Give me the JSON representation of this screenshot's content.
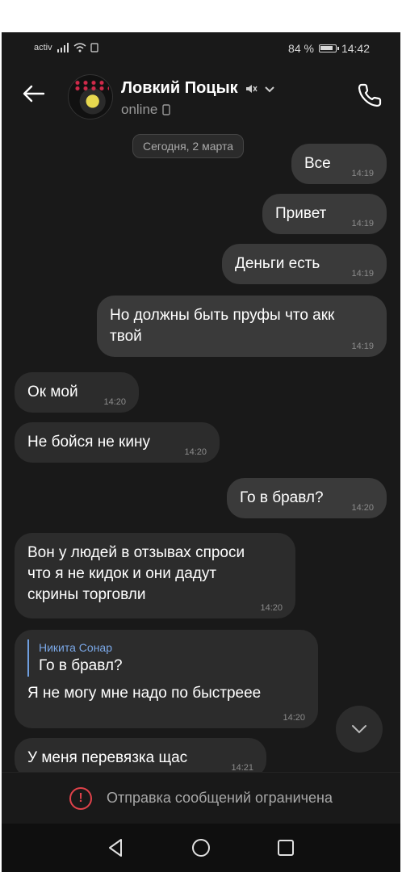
{
  "statusbar": {
    "carrier": "activ",
    "battery": "84 %",
    "time": "14:42"
  },
  "header": {
    "contact_name": "Ловкий Поцык",
    "status": "online",
    "icons": [
      "back-arrow-icon",
      "muted-icon",
      "chevron-down-icon",
      "phone-icon"
    ]
  },
  "date_separator": "Сегодня, 2 марта",
  "messages": [
    {
      "dir": "out",
      "text": "Все",
      "time": "14:19"
    },
    {
      "dir": "out",
      "text": "Привет",
      "time": "14:19"
    },
    {
      "dir": "out",
      "text": "Деньги есть",
      "time": "14:19"
    },
    {
      "dir": "out",
      "text": "Но должны быть пруфы что акк\nтвой",
      "time": "14:19"
    },
    {
      "dir": "in",
      "text": "Ок мой",
      "time": "14:20"
    },
    {
      "dir": "in",
      "text": "Не бойся не кину",
      "time": "14:20"
    },
    {
      "dir": "out",
      "text": "Го в бравл?",
      "time": "14:20"
    },
    {
      "dir": "in",
      "text": "Вон у людей в отзывах спроси\nчто я не кидок и они дадут\nскрины торговли",
      "time": "14:20"
    },
    {
      "dir": "in",
      "reply_name": "Никита Сонар",
      "reply_text": "Го в бравл?",
      "text": "Я не могу мне надо по быстрееe",
      "time": "14:20"
    },
    {
      "dir": "in",
      "text": "У меня перевязка щас",
      "time": "14:21"
    }
  ],
  "restricted_notice": "Отправка сообщений ограничена",
  "colors": {
    "background": "#191919",
    "bubble_out": "#3a3a3a",
    "bubble_in": "#2c2c2c",
    "reply_accent": "#7aa7e6",
    "warning": "#e0424a"
  }
}
